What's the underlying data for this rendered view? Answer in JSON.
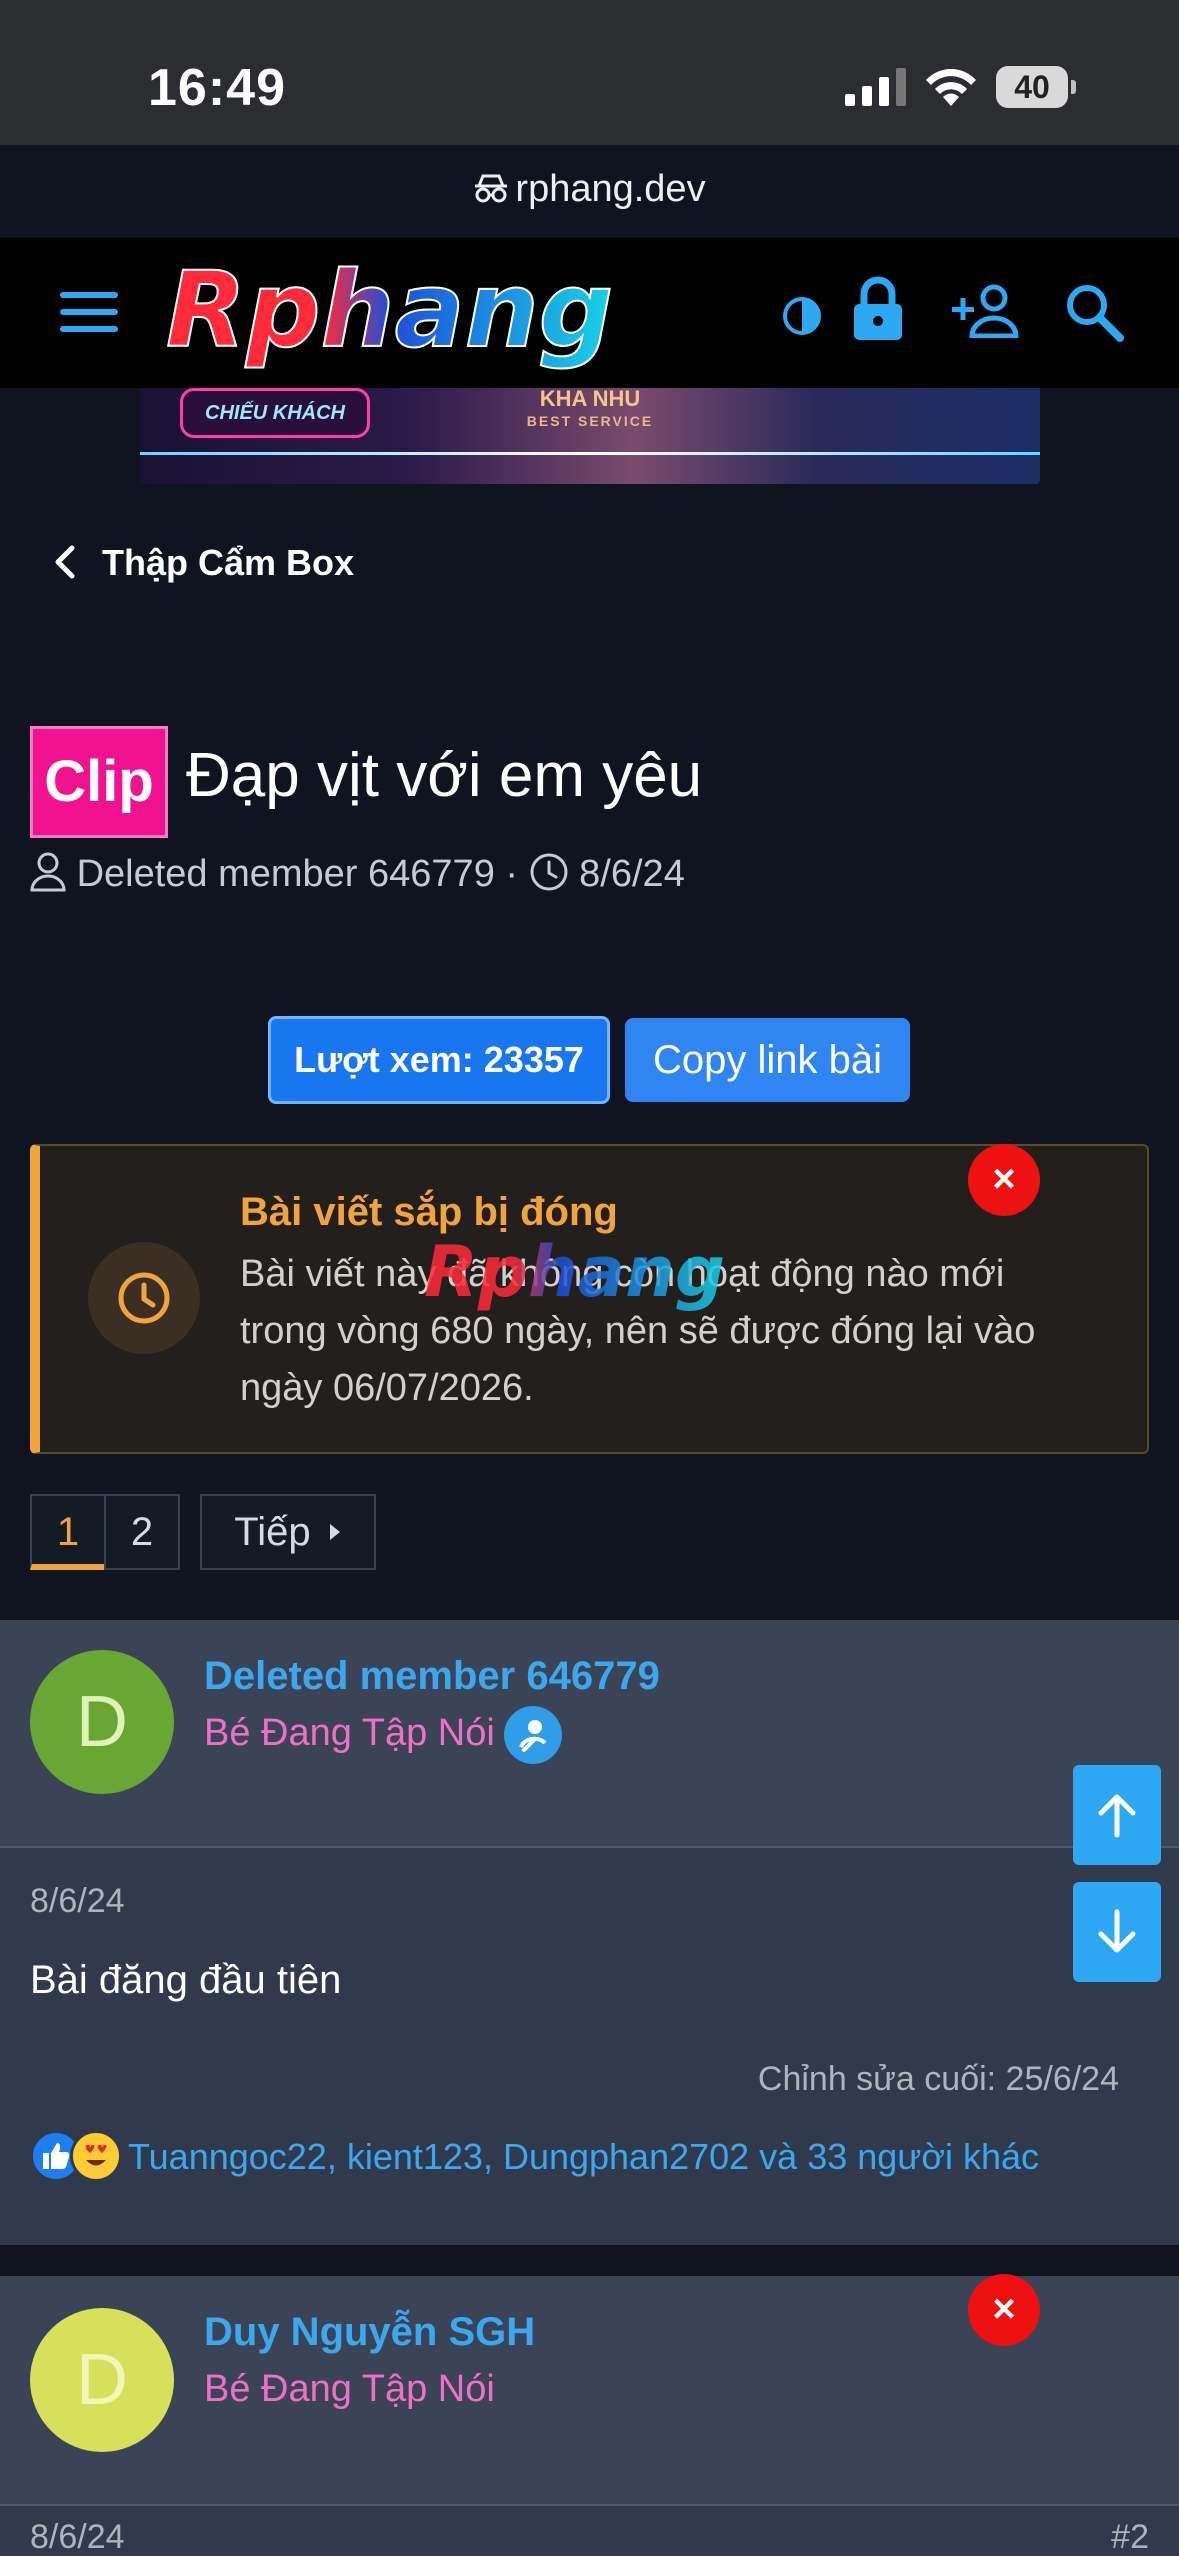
{
  "status": {
    "time": "16:49",
    "battery": "40",
    "url": "rphang.dev"
  },
  "header": {
    "logo_text": "Rphang"
  },
  "banner": {
    "left_label": "CHIẾU KHÁCH",
    "mid_label": "KHA NHU",
    "mid_sub": "BEST SERVICE"
  },
  "breadcrumb": {
    "label": "Thập Cẩm Box"
  },
  "thread": {
    "prefix": "Clip",
    "title": "Đạp vịt với em yêu",
    "author": "Deleted member 646779",
    "date": "8/6/24",
    "sep": "·"
  },
  "actions": {
    "views": "Lượt xem: 23357",
    "copy": "Copy link bài"
  },
  "notice": {
    "title": "Bài viết sắp bị đóng",
    "body": "Bài viết này đã không còn hoạt động nào mới trong vòng 680 ngày, nên sẽ được đóng lại vào ngày 06/07/2026.",
    "close": "×"
  },
  "pagination": {
    "pages": [
      "1",
      "2"
    ],
    "next": "Tiếp"
  },
  "posts": [
    {
      "avatar_letter": "D",
      "avatar_color": "#6aa634",
      "username": "Deleted member 646779",
      "rank": "Bé Đang Tập Nói",
      "date": "8/6/24",
      "body": "Bài đăng đầu tiên",
      "edited": "Chỉnh sửa cuối: 25/6/24",
      "reactions": "Tuanngoc22, kient123, Dungphan2702 và 33 người khác"
    },
    {
      "avatar_letter": "D",
      "avatar_color": "#d6e05a",
      "username": "Duy Nguyễn SGH",
      "rank": "Bé Đang Tập Nói",
      "date": "8/6/24",
      "number": "#2",
      "close": "×"
    }
  ],
  "colors": {
    "accent": "#2ea8f3",
    "warning": "#f2a43c",
    "link": "#3aa7ee",
    "rank": "#f06fc6"
  }
}
